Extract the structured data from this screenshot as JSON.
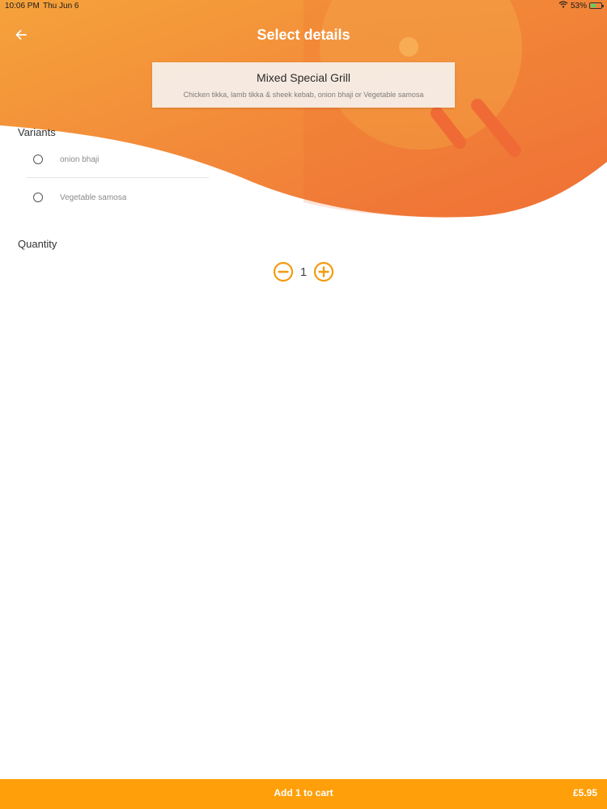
{
  "status_bar": {
    "time": "10:06 PM",
    "date": "Thu Jun 6",
    "battery_percent": "53%",
    "battery_level": 0.53,
    "wifi_icon": "wifi-icon",
    "battery_icon": "battery-charging-icon"
  },
  "header": {
    "title": "Select details",
    "back_icon": "arrow-left-icon"
  },
  "product": {
    "name": "Mixed Special Grill",
    "description": "Chicken tikka, lamb tikka & sheek kebab, onion bhaji or Vegetable samosa"
  },
  "variants": {
    "label": "Variants",
    "options": [
      {
        "label": "onion bhaji",
        "selected": false
      },
      {
        "label": "Vegetable samosa",
        "selected": false
      }
    ]
  },
  "quantity": {
    "label": "Quantity",
    "value": "1",
    "minus_icon": "minus-circle-icon",
    "plus_icon": "plus-circle-icon"
  },
  "cart": {
    "label": "Add 1 to cart",
    "price": "£5.95"
  },
  "colors": {
    "accent": "#f29b11",
    "header_gradient_start": "#f5a23b",
    "header_gradient_end": "#f07238",
    "cart_bar": "#ff9f0a"
  }
}
